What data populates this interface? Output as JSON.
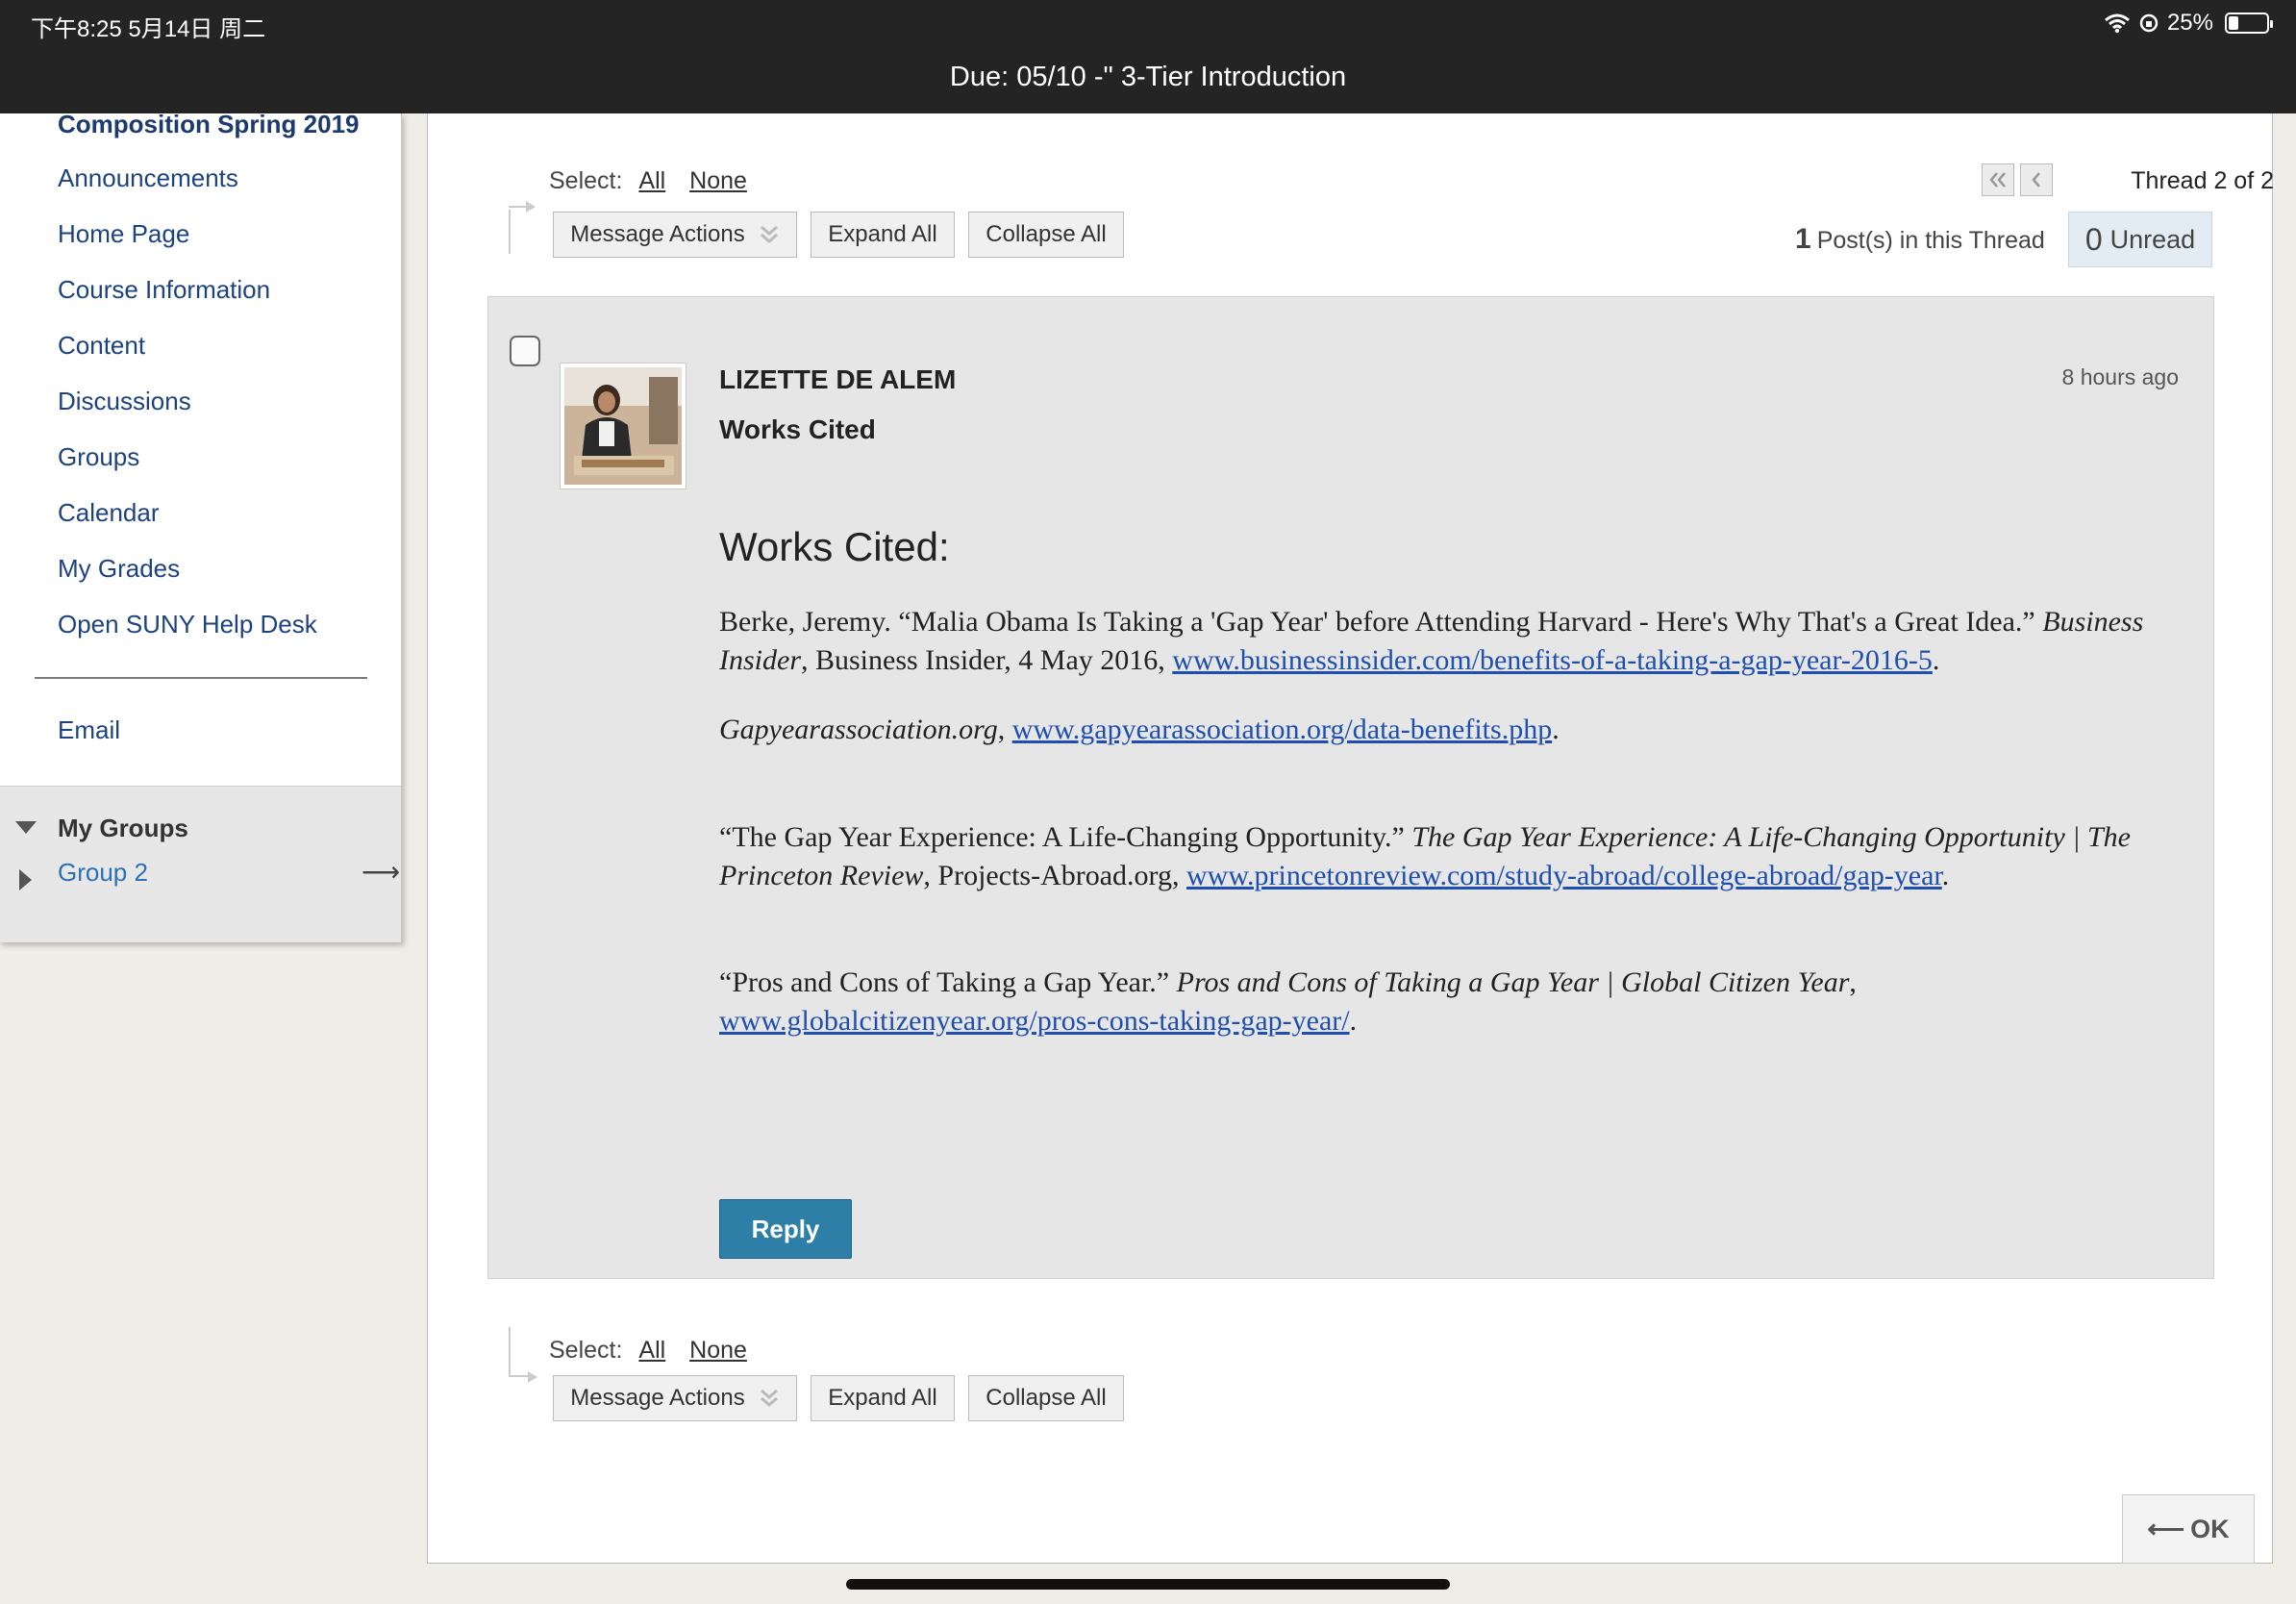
{
  "status_bar": {
    "time": "下午8:25   5月14日 周二",
    "battery": "25%"
  },
  "header": {
    "title": "Due: 05/10 -\" 3-Tier Introduction"
  },
  "sidebar": {
    "course_title": "Composition Spring 2019",
    "items": [
      {
        "label": "Announcements"
      },
      {
        "label": "Home Page"
      },
      {
        "label": "Course Information"
      },
      {
        "label": "Content"
      },
      {
        "label": "Discussions"
      },
      {
        "label": "Groups"
      },
      {
        "label": "Calendar"
      },
      {
        "label": "My Grades"
      },
      {
        "label": "Open SUNY Help Desk"
      },
      {
        "label": "Email"
      }
    ],
    "my_groups_label": "My Groups",
    "group_label": "Group 2",
    "group_arrow": "⟶"
  },
  "toolbar": {
    "select_label": "Select:",
    "all_label": "All",
    "none_label": "None",
    "message_actions": "Message Actions",
    "expand_all": "Expand All",
    "collapse_all": "Collapse All"
  },
  "thread": {
    "counter": "Thread 2 of 2",
    "posts_count": "1",
    "posts_label": "Post(s) in this Thread",
    "unread_count": "0",
    "unread_label": "Unread"
  },
  "post": {
    "author": "LIZETTE DE ALEM",
    "time_ago": "8 hours ago",
    "subject": "Works Cited",
    "heading": "Works Cited:",
    "citations": [
      {
        "a": "Berke, Jeremy. “Malia Obama Is Taking a 'Gap Year' before Attending Harvard - Here's Why That's a Great Idea.” ",
        "b": "Business Insider",
        "c": ", Business Insider, 4 May 2016, ",
        "url": "www.businessinsider.com/benefits-of-a-taking-a-gap-year-2016-5",
        "d": "."
      },
      {
        "a": "",
        "b": "Gapyearassociation.org",
        "c": ", ",
        "url": "www.gapyearassociation.org/data-benefits.php",
        "d": "."
      },
      {
        "a": "“The Gap Year Experience: A Life-Changing Opportunity.” ",
        "b": "The Gap Year Experience: A Life-Changing Opportunity | The Princeton Review",
        "c": ", Projects-Abroad.org, ",
        "url": "www.princetonreview.com/study-abroad/college-abroad/gap-year",
        "d": "."
      },
      {
        "a": "“Pros and Cons of Taking a Gap Year.” ",
        "b": "Pros and Cons of Taking a Gap Year | Global Citizen Year",
        "c": ", ",
        "url": "www.globalcitizenyear.org/pros-cons-taking-gap-year/",
        "d": "."
      }
    ],
    "reply_label": "Reply"
  },
  "ok_button": {
    "arrow": "⟵",
    "label": "OK"
  },
  "colors": {
    "topbar": "#242424",
    "link": "#1e4fb0",
    "nav": "#1d4280",
    "reply": "#2e7fa8"
  }
}
